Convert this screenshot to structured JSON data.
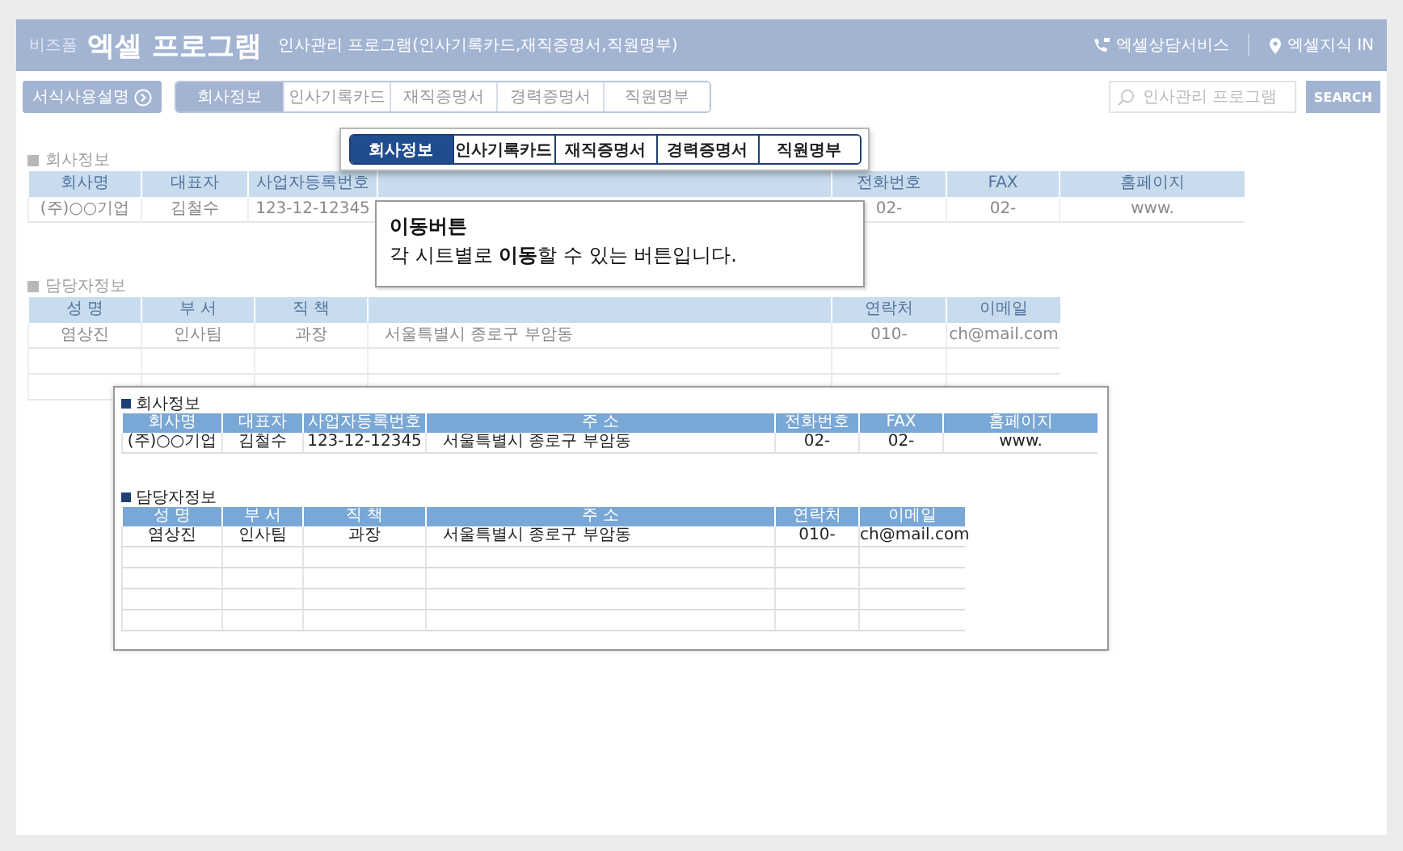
{
  "header": {
    "brand": "비즈폼",
    "title": "엑셀 프로그램",
    "subtitle": "인사관리 프로그램(인사기록카드,재직증명서,직원명부)",
    "links": [
      {
        "label": "엑셀상담서비스",
        "kind": "phone"
      },
      {
        "label": "엑셀지식 IN",
        "kind": "pin"
      }
    ]
  },
  "toolbar": {
    "guide_button": "서식사용설명",
    "tabs": [
      {
        "label": "회사정보",
        "selected": true
      },
      {
        "label": "인사기록카드",
        "selected": false
      },
      {
        "label": "재직증명서",
        "selected": false
      },
      {
        "label": "경력증명서",
        "selected": false
      },
      {
        "label": "직원명부",
        "selected": false
      }
    ],
    "search": {
      "placeholder": "인사관리 프로그램",
      "button": "SEARCH"
    }
  },
  "company": {
    "title": "회사정보",
    "columns": [
      "회사명",
      "대표자",
      "사업자등록번호",
      null,
      "전화번호",
      "FAX",
      "홈페이지"
    ],
    "rows": [
      [
        "(주)○○기업",
        "김철수",
        "123-12-12345",
        null,
        "02-",
        "02-",
        "www."
      ]
    ]
  },
  "contact": {
    "title": "담당자정보",
    "columns": [
      "성 명",
      "부 서",
      "직 책",
      null,
      "연락처",
      "이메일"
    ],
    "rows": [
      [
        "염상진",
        "인사팀",
        "과장",
        "서울특별시 종로구 부암동",
        "010-",
        "ch@mail.com"
      ]
    ]
  },
  "zoom_tabs": [
    {
      "label": "회사정보",
      "selected": true
    },
    {
      "label": "인사기록카드",
      "selected": false
    },
    {
      "label": "재직증명서",
      "selected": false
    },
    {
      "label": "경력증명서",
      "selected": false
    },
    {
      "label": "직원명부",
      "selected": false
    }
  ],
  "callout": {
    "title": "이동버튼",
    "text": "각 시트별로 **이동**할 수 있는 버튼입니다."
  },
  "inset": {
    "company": {
      "title": "회사정보",
      "columns": [
        "회사명",
        "대표자",
        "사업자등록번호",
        "주 소",
        "전화번호",
        "FAX",
        "홈페이지"
      ],
      "rows": [
        [
          "(주)○○기업",
          "김철수",
          "123-12-12345",
          "서울특별시 종로구 부암동",
          "02-",
          "02-",
          "www."
        ]
      ]
    },
    "contact": {
      "title": "담당자정보",
      "columns": [
        "성 명",
        "부 서",
        "직 책",
        "주 소",
        "연락처",
        "이메일"
      ],
      "rows": [
        [
          "염상진",
          "인사팀",
          "과장",
          "서울특별시 종로구 부암동",
          "010-",
          "ch@mail.com"
        ]
      ]
    }
  }
}
